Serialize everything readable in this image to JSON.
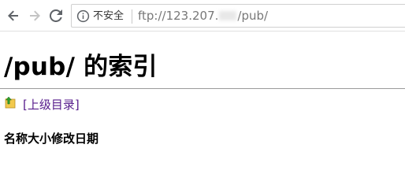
{
  "toolbar": {
    "back_icon": "back-arrow-icon",
    "forward_icon": "forward-arrow-icon",
    "reload_icon": "reload-icon",
    "security_icon": "info-circle-icon",
    "security_label": "不安全",
    "url_prefix": "ftp://123.207.",
    "url_suffix": "/pub/"
  },
  "page": {
    "title": "/pub/ 的索引",
    "parent_link": "[上级目录]",
    "parent_icon": "folder-up-icon",
    "columns": [
      "名称",
      "大小",
      "修改日期"
    ]
  },
  "colors": {
    "link_visited": "#551a8b",
    "folder_yellow": "#f2c94c",
    "arrow_green": "#2e9e2e"
  }
}
